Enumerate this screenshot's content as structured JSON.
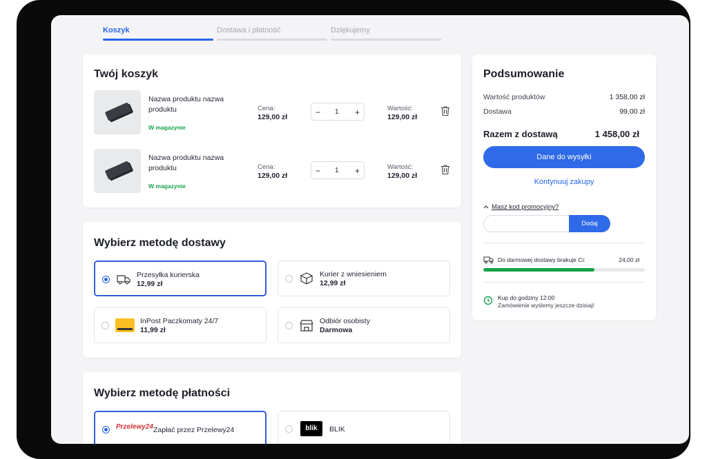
{
  "steps": [
    {
      "label": "Koszyk",
      "active": true
    },
    {
      "label": "Dostawa i płatność",
      "active": false
    },
    {
      "label": "Dziękujemy",
      "active": false
    }
  ],
  "cart": {
    "title": "Twój koszyk",
    "items": [
      {
        "name": "Nazwa produktu nazwa produktu",
        "stock": "W magazynie",
        "price_label": "Cena:",
        "price": "129,00 zł",
        "qty": "1",
        "minus": "−",
        "plus": "+",
        "value_label": "Wartość:",
        "value": "129,00 zł"
      },
      {
        "name": "Nazwa produktu nazwa produktu",
        "stock": "W magazynie",
        "price_label": "Cena:",
        "price": "129,00 zł",
        "qty": "1",
        "minus": "−",
        "plus": "+",
        "value_label": "Wartość:",
        "value": "129,00 zł"
      }
    ]
  },
  "delivery": {
    "title": "Wybierz metodę dostawy",
    "options": [
      {
        "name": "Przesyłka kurierska",
        "price": "12,99 zł",
        "icon": "truck-icon",
        "selected": true
      },
      {
        "name": "Kurier z wniesieniem",
        "price": "12,99 zł",
        "icon": "box-icon",
        "selected": false
      },
      {
        "name": "InPost Paczkomaty 24/7",
        "price": "11,99 zł",
        "icon": "inpost-logo",
        "selected": false
      },
      {
        "name": "Odbiór osobisty",
        "price": "Darmowa",
        "icon": "store-icon",
        "selected": false
      }
    ]
  },
  "payment": {
    "title": "Wybierz metodę płatności",
    "options": [
      {
        "name": "Zapłać przez Przelewy24",
        "logo_text": "Przelewy24",
        "selected": true
      },
      {
        "name": "BLIK",
        "logo_text": "blik",
        "selected": false
      }
    ]
  },
  "summary": {
    "title": "Podsumowanie",
    "products_label": "Wartość produktów",
    "products_value": "1 358,00 zł",
    "shipping_label": "Dostawa",
    "shipping_value": "99,00 zł",
    "total_label": "Razem z dostawą",
    "total_value": "1 458,00 zł",
    "cta": "Dane do wysyłki",
    "continue": "Kontynuuj zakupy",
    "promo_toggle": "Masz kod promocyjny?",
    "promo_placeholder": "",
    "promo_button": "Dodaj",
    "free_shipping_text": "Do darmowej dostawy brakuje Ci:",
    "free_shipping_value": "24,00 zł",
    "free_shipping_progress": 0.69,
    "deadline_title": "Kup do godziny 12:00",
    "deadline_text": "Zamówienie wyślemy jeszcze dzisiaj!"
  },
  "colors": {
    "accent": "#2f6ae8",
    "success": "#16a34a",
    "danger": "#d13438"
  }
}
